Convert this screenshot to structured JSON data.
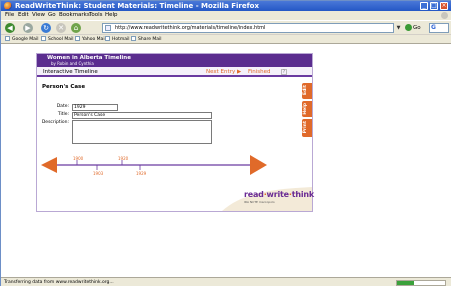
{
  "window": {
    "title": "ReadWriteThink: Student Materials: Timeline - Mozilla Firefox",
    "minimize": "_",
    "maximize": "□",
    "close": "×"
  },
  "menu": [
    "File",
    "Edit",
    "View",
    "Go",
    "Bookmarks",
    "Tools",
    "Help"
  ],
  "nav": {
    "back": "◀",
    "forward": "▶",
    "reload": "↻",
    "stop": "✕",
    "home": "⌂",
    "url": "http://www.readwritethink.org/materials/timeline/index.html",
    "url_dropdown": "▼",
    "go_label": "Go",
    "search_logo": "G"
  },
  "bookmarks": [
    "Google Mail",
    "School Mail",
    "Yahoo Mail",
    "Hotmail",
    "Share Mail"
  ],
  "timeline_app": {
    "header_title": "Women in Alberta Timeline",
    "header_subtitle": "by Robin and Cynthia",
    "bar_label": "Interactive Timeline",
    "next_entry": "Next Entry ▶",
    "finished": "Finished",
    "help_icon": "?",
    "entry_heading": "Person's Case",
    "fields": {
      "date_label": "Date:",
      "date_value": "1929",
      "title_label": "Title:",
      "title_value": "Person's Case",
      "description_label": "Description:",
      "description_value": ""
    },
    "side_tabs": [
      "Edit",
      "Help",
      "Print"
    ],
    "years_top": [
      "1900",
      "1920"
    ],
    "years_bottom": [
      "1903",
      "1929"
    ],
    "brand": {
      "read": "read",
      "dot1": "·",
      "write": "write",
      "dot2": "·",
      "think": "think",
      "partners": "IRA  NCTE  marcopolo"
    },
    "colors": {
      "header": "#5b2d8f",
      "accent": "#e06a2a",
      "brand_purple": "#6a2b94"
    }
  },
  "status": {
    "message": "Transferring data from www.readwritethink.org...",
    "progress": 0.35
  }
}
